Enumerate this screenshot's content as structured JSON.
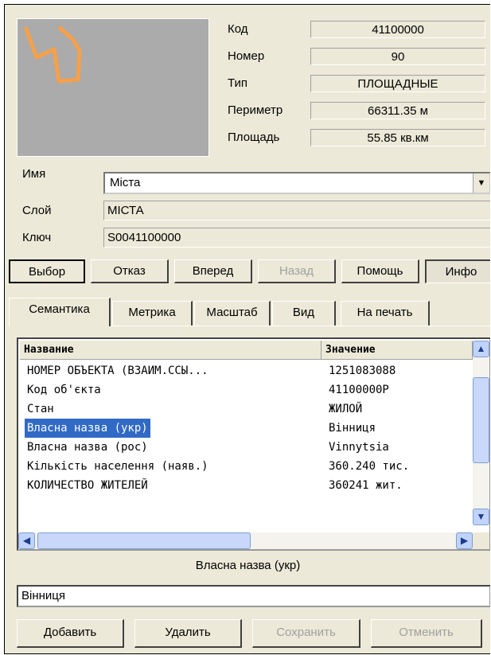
{
  "props": {
    "rows": [
      {
        "label": "Код",
        "value": "41100000"
      },
      {
        "label": "Номер",
        "value": "90"
      },
      {
        "label": "Тип",
        "value": "ПЛОЩАДНЫЕ"
      },
      {
        "label": "Периметр",
        "value": "66311.35 м"
      },
      {
        "label": "Площадь",
        "value": "55.85 кв.км"
      }
    ]
  },
  "fields": {
    "name_label": "Имя",
    "name_value": "Міста",
    "layer_label": "Слой",
    "layer_value": "МІСТА",
    "key_label": "Ключ",
    "key_value": "S0041100000"
  },
  "toolbar": {
    "select": "Выбор",
    "cancel": "Отказ",
    "forward": "Вперед",
    "back": "Назад",
    "help": "Помощь",
    "info": "Инфо"
  },
  "tabs": [
    "Семантика",
    "Метрика",
    "Масштаб",
    "Вид",
    "На печать"
  ],
  "semantics": {
    "col_name": "Название",
    "col_value": "Значение",
    "rows": [
      {
        "name": "НОМЕР ОБЪЕКТА (ВЗАИМ.ССЫ...",
        "value": "1251083088"
      },
      {
        "name": "Код об'єкта",
        "value": "41100000P"
      },
      {
        "name": "Стан",
        "value": "ЖИЛОЙ"
      },
      {
        "name": "Власна назва (укр)",
        "value": "Вінниця"
      },
      {
        "name": "Власна назва (рос)",
        "value": "Vinnytsia"
      },
      {
        "name": "Кількість населення (наяв.)",
        "value": "360.240 тис."
      },
      {
        "name": "КОЛИЧЕСТВО ЖИТЕЛЕЙ",
        "value": "360241 жит."
      }
    ],
    "selected_index": 3
  },
  "editor": {
    "caption": "Власна назва (укр)",
    "value": "Вінниця"
  },
  "bottom": {
    "add": "Добавить",
    "delete": "Удалить",
    "save": "Сохранить",
    "revert": "Отменить"
  },
  "colors": {
    "preview_bg": "#ababab",
    "shape_stroke": "#f5a04a",
    "selection": "#316ac5"
  },
  "icons": {
    "combo": "chevron-down-icon",
    "scroll_up": "arrow-up-icon",
    "scroll_down": "arrow-down-icon",
    "scroll_left": "arrow-left-icon",
    "scroll_right": "arrow-right-icon"
  }
}
